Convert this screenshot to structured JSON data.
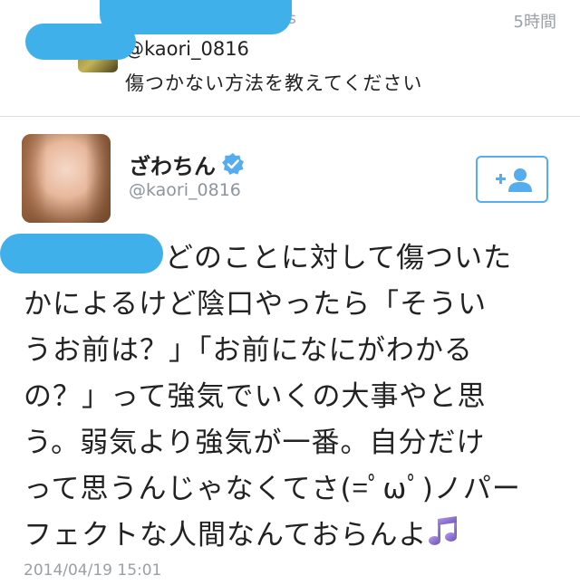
{
  "reply": {
    "time": "5時間",
    "name_tail": "s",
    "mention": "@kaori_0816",
    "text": "傷つかない方法を教えてください"
  },
  "tweet": {
    "display_name": "ざわちん",
    "handle": "@kaori_0816",
    "lines": [
      "どのことに対して傷ついた",
      "かによるけど陰口やったら「そうい",
      "うお前は？」「お前になにがわかる",
      "の？」って強気でいくの大事やと思",
      "う。弱気より強気が一番。自分だけ",
      "って思うんじゃなくてさ(=ﾟωﾟ)ノパー",
      "フェクトな人間なんておらんよ"
    ],
    "timestamp": "2014/04/19 15:01"
  },
  "colors": {
    "link_blue": "#55acee",
    "redaction_blue": "#3fb0ea",
    "note_purple": "#8a6fc9"
  },
  "icons": {
    "follow": "add-user-icon",
    "verified": "verified-badge-icon",
    "note": "music-note-icon"
  }
}
